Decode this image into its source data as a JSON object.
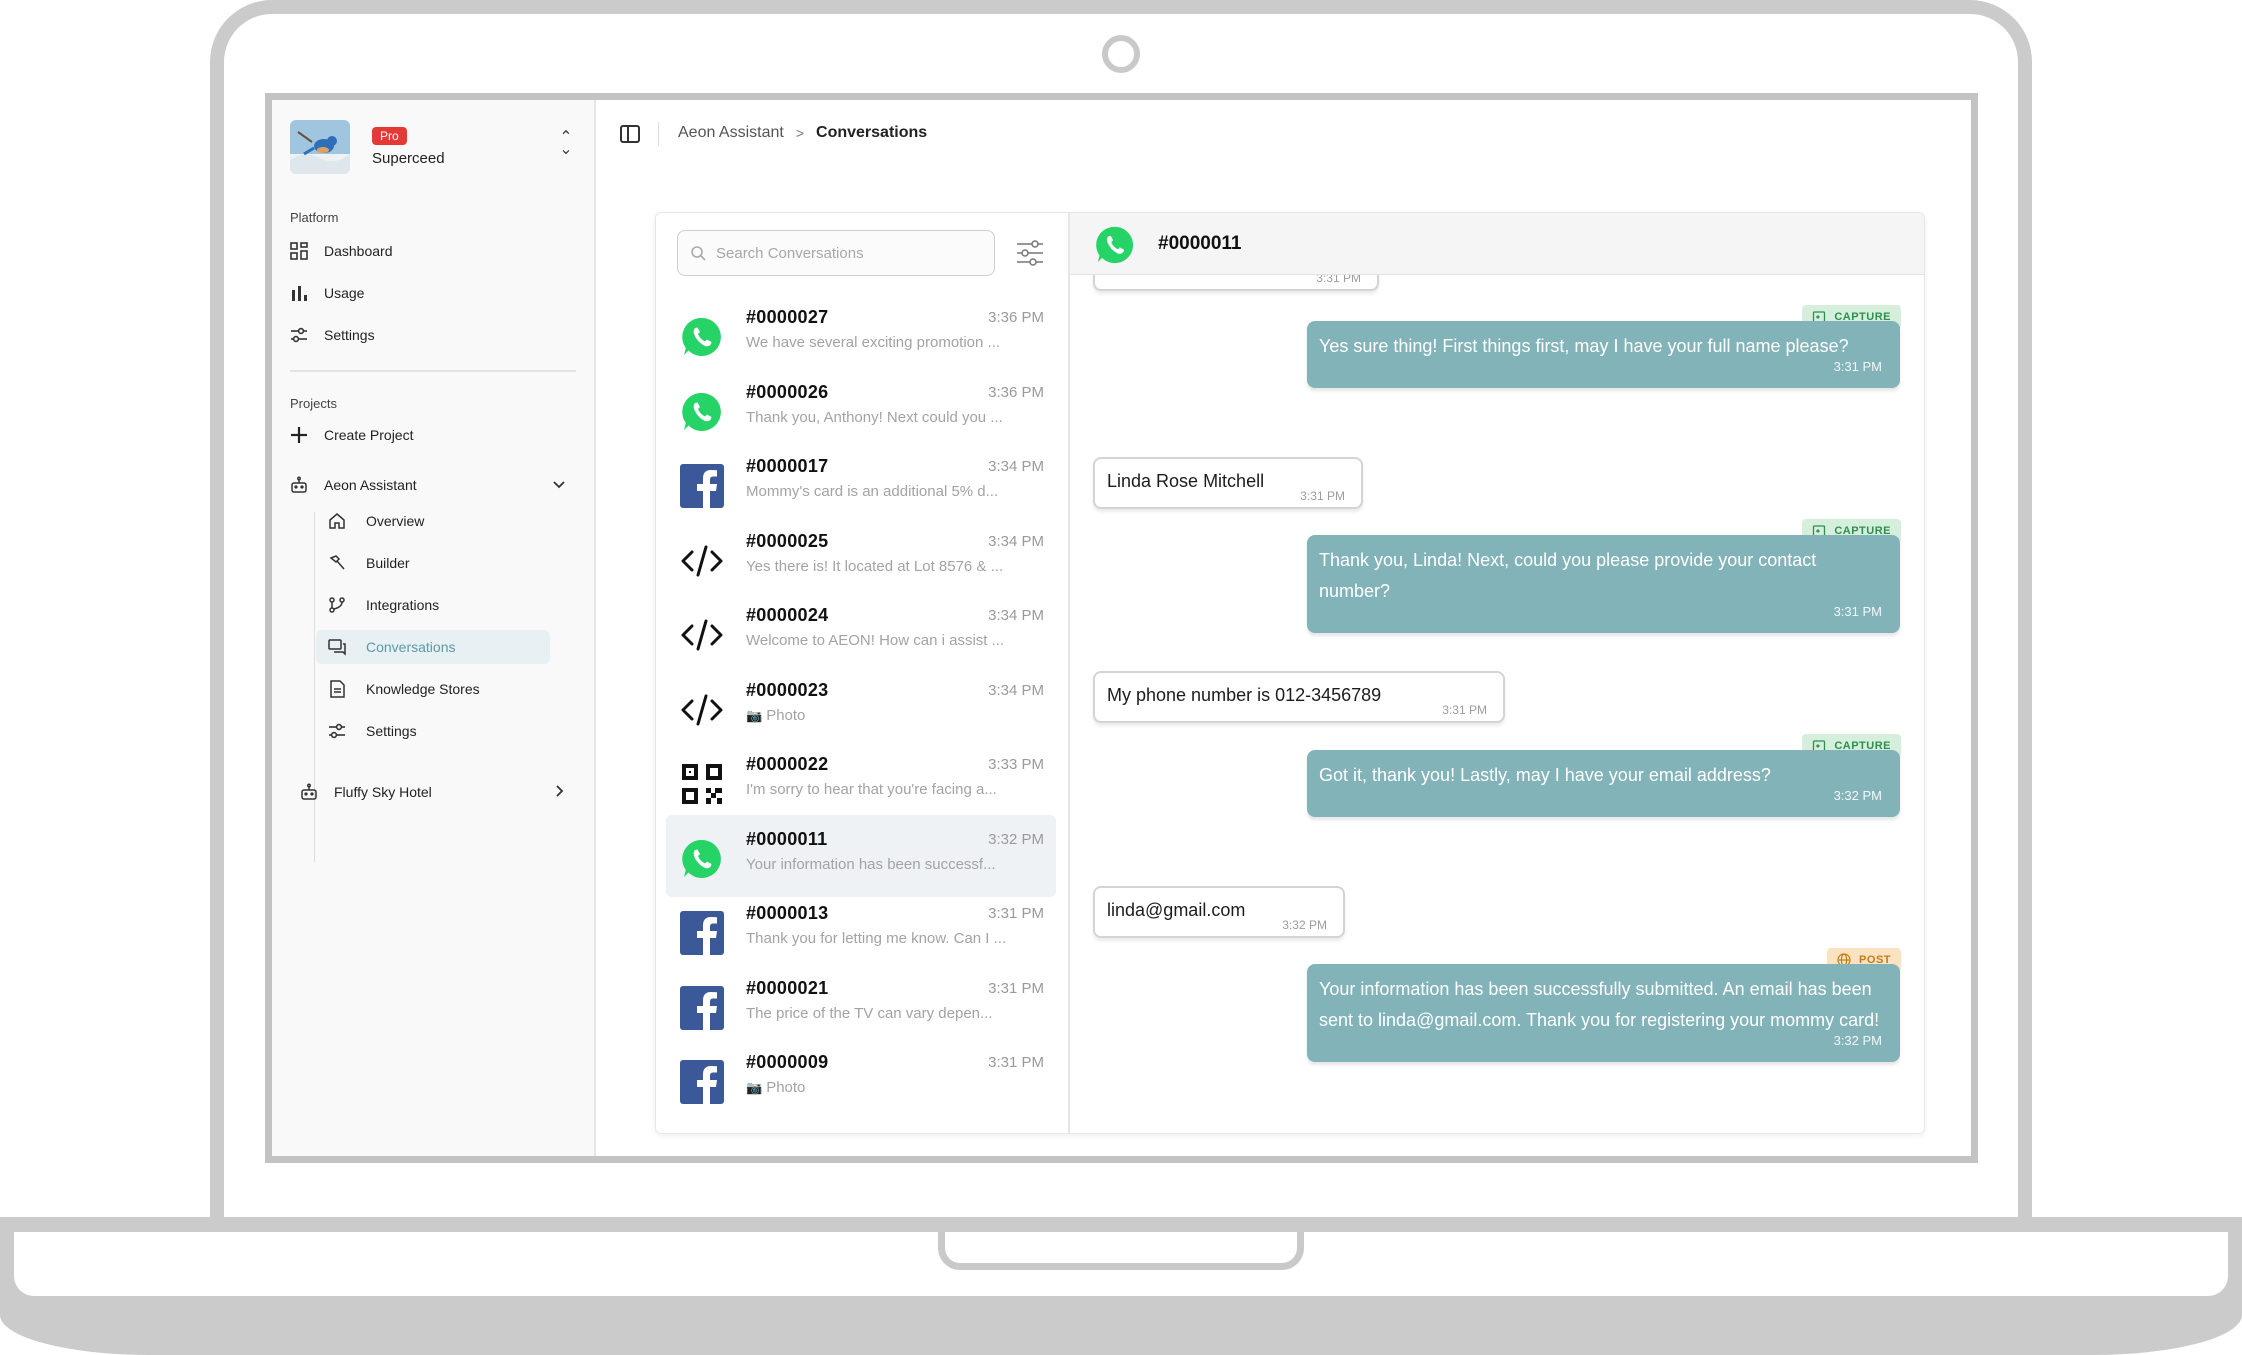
{
  "org": {
    "badge": "Pro",
    "name": "Superceed"
  },
  "sidebar": {
    "platform_label": "Platform",
    "platform_items": [
      {
        "label": "Dashboard",
        "icon": "grid-icon"
      },
      {
        "label": "Usage",
        "icon": "bar-chart-icon"
      },
      {
        "label": "Settings",
        "icon": "sliders-icon"
      }
    ],
    "projects_label": "Projects",
    "create_project": "Create Project",
    "project_1": {
      "label": "Aeon Assistant",
      "sub_items": [
        {
          "label": "Overview",
          "icon": "home-icon"
        },
        {
          "label": "Builder",
          "icon": "hammer-icon"
        },
        {
          "label": "Integrations",
          "icon": "git-branch-icon"
        },
        {
          "label": "Conversations",
          "icon": "chat-icon",
          "active": true
        },
        {
          "label": "Knowledge Stores",
          "icon": "document-icon"
        },
        {
          "label": "Settings",
          "icon": "sliders-icon"
        }
      ]
    },
    "project_2": {
      "label": "Fluffy Sky Hotel"
    }
  },
  "breadcrumb": {
    "root": "Aeon Assistant",
    "separator": ">",
    "current": "Conversations"
  },
  "search": {
    "placeholder": "Search Conversations",
    "value": ""
  },
  "conversations": [
    {
      "id": "#0000027",
      "time": "3:36 PM",
      "preview": "We have several exciting promotion ...",
      "channel": "whatsapp"
    },
    {
      "id": "#0000026",
      "time": "3:36 PM",
      "preview": "Thank you, Anthony! Next could you ...",
      "channel": "whatsapp"
    },
    {
      "id": "#0000017",
      "time": "3:34 PM",
      "preview": "Mommy's card is an additional 5% d...",
      "channel": "facebook"
    },
    {
      "id": "#0000025",
      "time": "3:34 PM",
      "preview": "Yes there is! It located at Lot 8576 & ...",
      "channel": "web"
    },
    {
      "id": "#0000024",
      "time": "3:34 PM",
      "preview": "Welcome to AEON! How can i assist ...",
      "channel": "web"
    },
    {
      "id": "#0000023",
      "time": "3:34 PM",
      "preview": "Photo",
      "channel": "web",
      "photo": true
    },
    {
      "id": "#0000022",
      "time": "3:33 PM",
      "preview": "I'm sorry to hear that you're facing a...",
      "channel": "qr"
    },
    {
      "id": "#0000011",
      "time": "3:32 PM",
      "preview": "Your information has been successf...",
      "channel": "whatsapp",
      "selected": true
    },
    {
      "id": "#0000013",
      "time": "3:31 PM",
      "preview": "Thank you for letting me know. Can I ...",
      "channel": "facebook"
    },
    {
      "id": "#0000021",
      "time": "3:31 PM",
      "preview": "The price of the TV can vary depen...",
      "channel": "facebook"
    },
    {
      "id": "#0000009",
      "time": "3:31 PM",
      "preview": "Photo",
      "channel": "facebook",
      "photo": true
    }
  ],
  "chat": {
    "id": "#0000011",
    "channel": "whatsapp",
    "partial_top_time": "3:31 PM",
    "messages": [
      {
        "dir": "out",
        "tag": "CAPTURE",
        "text": "Yes sure thing! First things first, may I have your full name please?",
        "time": "3:31 PM"
      },
      {
        "dir": "in",
        "text": "Linda Rose Mitchell",
        "time": "3:31 PM"
      },
      {
        "dir": "out",
        "tag": "CAPTURE",
        "text": "Thank you, Linda! Next, could you please provide your contact number?",
        "time": "3:31 PM"
      },
      {
        "dir": "in",
        "text": "My phone number is 012-3456789",
        "time": "3:31 PM"
      },
      {
        "dir": "out",
        "tag": "CAPTURE",
        "text": "Got it, thank you! Lastly, may I have your email address?",
        "time": "3:32 PM"
      },
      {
        "dir": "in",
        "text": "linda@gmail.com",
        "time": "3:32 PM"
      },
      {
        "dir": "out",
        "tag": "POST",
        "text": "Your information has been successfully submitted. An email has been sent to linda@gmail.com. Thank you for registering your mommy card!",
        "time": "3:32 PM"
      }
    ]
  },
  "colors": {
    "accent": "#82b3b9",
    "whatsapp": "#25d366",
    "facebook": "#3b5998",
    "capture_tag_bg": "#d6efdc",
    "post_tag_bg": "#fbe3c2",
    "pro_badge": "#e53935"
  }
}
